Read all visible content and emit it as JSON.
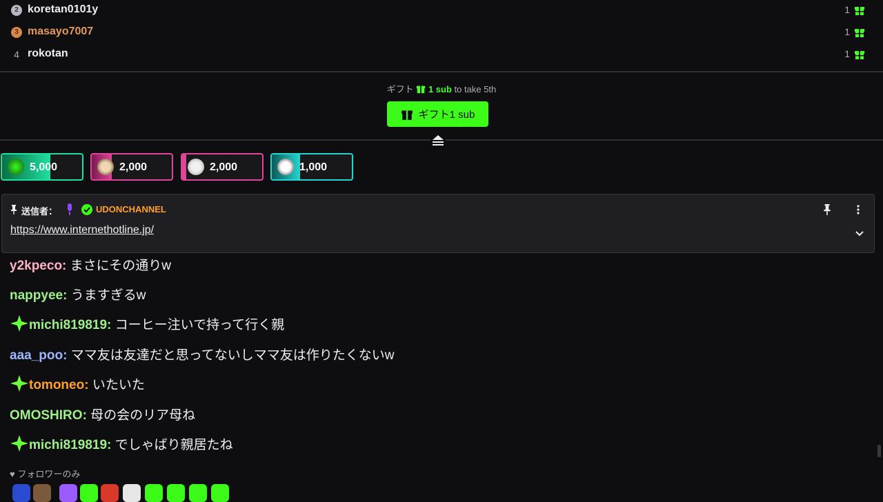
{
  "leaderboard": [
    {
      "rank": "2",
      "name": "koretan0101y",
      "count": "1"
    },
    {
      "rank": "3",
      "name": "masayo7007",
      "count": "1"
    },
    {
      "rank": "4",
      "name": "rokotan",
      "count": "1"
    }
  ],
  "gift": {
    "hint_prefix": "ギフト",
    "hint_sub": "1 sub",
    "hint_suffix": "to take 5th",
    "button_label": "ギフト1 sub"
  },
  "hype_chips": [
    {
      "amount": "5,000",
      "accent": "#1fe0a0",
      "progress": 0.6
    },
    {
      "amount": "2,000",
      "accent": "#e0459a",
      "progress": 0.25
    },
    {
      "amount": "2,000",
      "accent": "#e0459a",
      "progress": 0.05
    },
    {
      "amount": "1,000",
      "accent": "#24d6d0",
      "progress": 0.35
    }
  ],
  "pinned": {
    "label": "送信者：",
    "username": "UDONCHANNEL",
    "link": "https://www.internethotline.jp/"
  },
  "chat": [
    {
      "user": "y2kpeco",
      "message": "まさにその通りw",
      "color": "#ffb3c8",
      "badge": false
    },
    {
      "user": "nappyee",
      "message": "うますぎるw",
      "color": "#9ef08a",
      "badge": false
    },
    {
      "user": "michi819819",
      "message": "コーヒー注いで持って行く親",
      "color": "#9ef08a",
      "badge": true
    },
    {
      "user": "aaa_poo",
      "message": "ママ友は友達だと思ってないしママ友は作りたくないw",
      "color": "#9cb7ff",
      "badge": false
    },
    {
      "user": "tomoneo",
      "message": "いたいた",
      "color": "#ff9f2c",
      "badge": true
    },
    {
      "user": "OMOSHIRO",
      "message": "母の会のリア母ね",
      "color": "#9ef08a",
      "badge": false
    },
    {
      "user": "michi819819",
      "message": "でしゃばり親居たね",
      "color": "#9ef08a",
      "badge": true
    }
  ],
  "followers_only": "フォロワーのみ",
  "colors": {
    "accent_green": "#3cfb18",
    "bg": "#0e0e10"
  }
}
